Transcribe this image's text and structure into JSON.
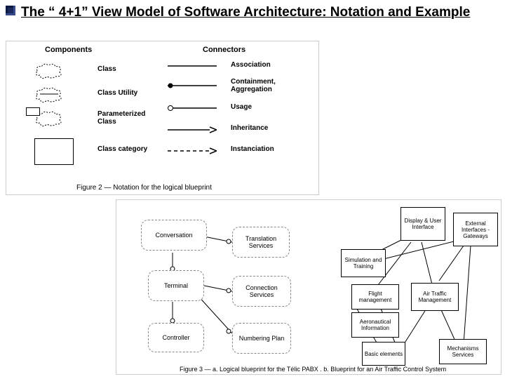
{
  "title": "The “ 4+1” View Model of Software Architecture: Notation and Example",
  "fig2": {
    "components_header": "Components",
    "connectors_header": "Connectors",
    "components": {
      "class": "Class",
      "class_utility": "Class Utility",
      "parameterized": "Parameterized Class",
      "category": "Class category"
    },
    "connectors": {
      "association": "Association",
      "containment": "Containment, Aggregation",
      "usage": "Usage",
      "inheritance": "Inheritance",
      "instanciation": "Instanciation"
    },
    "caption": "Figure 2 — Notation for the logical blueprint"
  },
  "fig3": {
    "left": {
      "conversation": "Conversation",
      "translation": "Translation Services",
      "terminal": "Terminal",
      "connection": "Connection Services",
      "controller": "Controller",
      "numbering": "Numbering Plan"
    },
    "right": {
      "display": "Display & User Interface",
      "external": "External Interfaces -Gateways",
      "simulation": "Simulation and Training",
      "flight": "Flight management",
      "atm": "Air Traffic Management",
      "aero": "Aeronautical Information",
      "basic": "Basic elements",
      "mech": "Mechanisms Services"
    },
    "caption": "Figure 3 — a. Logical blueprint for the Télic PABX . b. Blueprint for an Air Traffic Control System"
  }
}
